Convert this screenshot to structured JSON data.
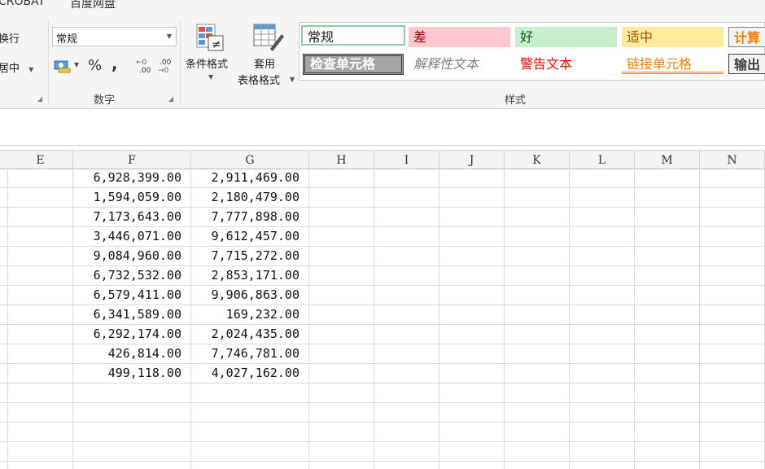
{
  "ribbon": {
    "tabs": [
      "CROBAT",
      "百度网盘"
    ],
    "alignment": {
      "wrap_label": "换行",
      "merge_label": "居中"
    },
    "number": {
      "format_value": "常规",
      "percent_symbol": "%",
      "comma_symbol": ",",
      "increase_decimal": ".00",
      "decrease_decimal": ".00",
      "group_label": "数字"
    },
    "styles_group": {
      "conditional_format_label": "条件格式",
      "table_format_label_1": "套用",
      "table_format_label_2": "表格格式",
      "group_label": "样式",
      "cells": [
        {
          "label": "常规",
          "bg": "#ffffff",
          "color": "#222222"
        },
        {
          "label": "差",
          "bg": "#ffc7ce",
          "color": "#9c0006"
        },
        {
          "label": "好",
          "bg": "#c6efce",
          "color": "#006100"
        },
        {
          "label": "适中",
          "bg": "#ffeb9c",
          "color": "#9c5700"
        },
        {
          "label": "计算",
          "bg": "#f2f2f2",
          "color": "#fa7d00"
        },
        {
          "label": "检查单元格",
          "bg": "#a5a5a5",
          "color": "#ffffff"
        },
        {
          "label": "解释性文本",
          "bg": "#ffffff",
          "color": "#7f7f7f"
        },
        {
          "label": "警告文本",
          "bg": "#ffffff",
          "color": "#ff0000"
        },
        {
          "label": "链接单元格",
          "bg": "#ffffff",
          "color": "#fa7d00"
        },
        {
          "label": "输出",
          "bg": "#f2f2f2",
          "color": "#3f3f3f"
        }
      ]
    }
  },
  "sheet": {
    "columns": [
      "E",
      "F",
      "G",
      "H",
      "I",
      "J",
      "K",
      "L",
      "M",
      "N"
    ],
    "rows": [
      [
        "6,928,399.00",
        "2,911,469.00"
      ],
      [
        "1,594,059.00",
        "2,180,479.00"
      ],
      [
        "7,173,643.00",
        "7,777,898.00"
      ],
      [
        "3,446,071.00",
        "9,612,457.00"
      ],
      [
        "9,084,960.00",
        "7,715,272.00"
      ],
      [
        "6,732,532.00",
        "2,853,171.00"
      ],
      [
        "6,579,411.00",
        "9,906,863.00"
      ],
      [
        "6,341,589.00",
        "169,232.00"
      ],
      [
        "6,292,174.00",
        "2,024,435.00"
      ],
      [
        "426,814.00",
        "7,746,781.00"
      ],
      [
        "499,118.00",
        "4,027,162.00"
      ]
    ]
  }
}
